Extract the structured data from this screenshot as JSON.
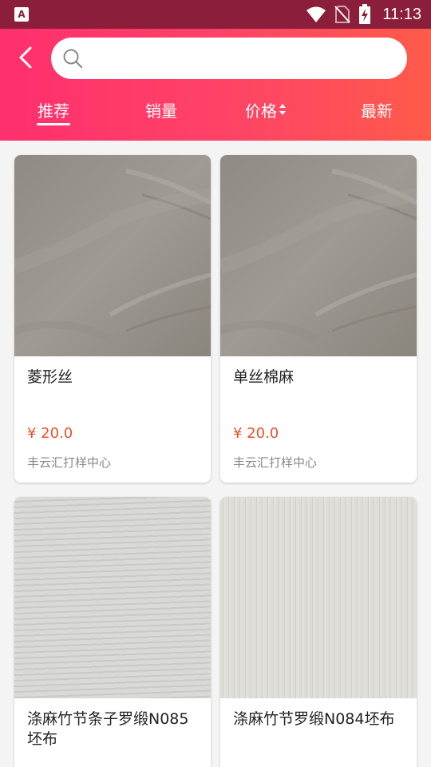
{
  "status_bar": {
    "time": "11:13",
    "app_icon_letter": "A"
  },
  "search": {
    "placeholder": "",
    "value": ""
  },
  "tabs": [
    {
      "label": "推荐",
      "active": true
    },
    {
      "label": "销量",
      "active": false
    },
    {
      "label": "价格",
      "active": false
    },
    {
      "label": "最新",
      "active": false
    }
  ],
  "products": [
    {
      "title": "菱形丝",
      "price": "¥ 20.0",
      "shop": "丰云汇打样中心"
    },
    {
      "title": "单丝棉麻",
      "price": "¥ 20.0",
      "shop": "丰云汇打样中心"
    },
    {
      "title": "涤麻竹节条子罗缎N085坯布",
      "price": "",
      "shop": ""
    },
    {
      "title": "涤麻竹节罗缎N084坯布",
      "price": "",
      "shop": ""
    }
  ],
  "colors": {
    "accent": "#ff3a6a",
    "price": "#f0502a",
    "status_bar": "#8b1e3a"
  }
}
